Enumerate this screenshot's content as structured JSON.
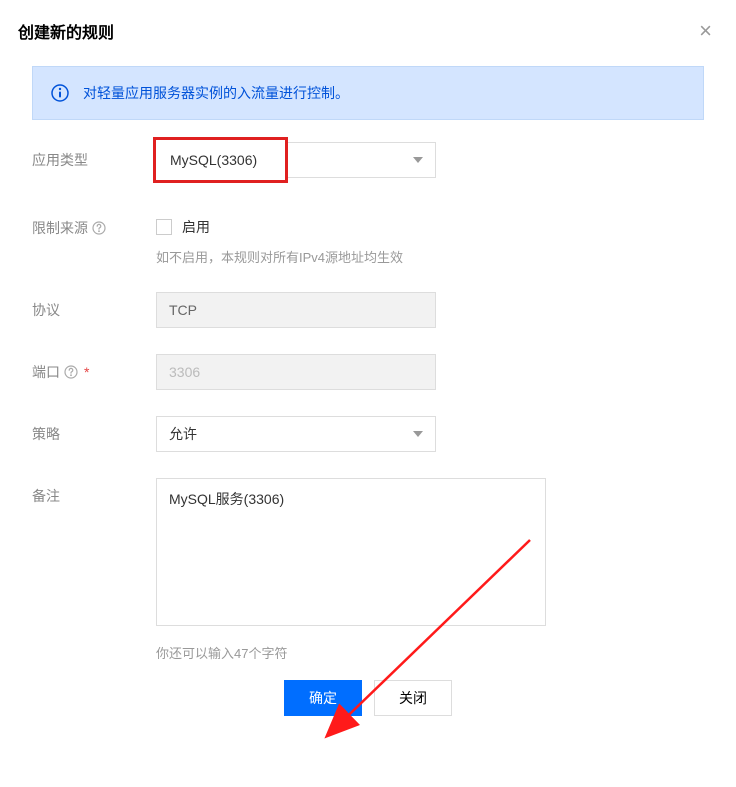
{
  "dialog": {
    "title": "创建新的规则",
    "banner": "对轻量应用服务器实例的入流量进行控制。"
  },
  "form": {
    "appType": {
      "label": "应用类型",
      "value": "MySQL(3306)"
    },
    "restrictSource": {
      "label": "限制来源",
      "checkboxLabel": "启用",
      "hint": "如不启用，本规则对所有IPv4源地址均生效"
    },
    "protocol": {
      "label": "协议",
      "value": "TCP"
    },
    "port": {
      "label": "端口",
      "value": "3306"
    },
    "policy": {
      "label": "策略",
      "value": "允许"
    },
    "remark": {
      "label": "备注",
      "value": "MySQL服务(3306)",
      "hint": "你还可以输入47个字符"
    }
  },
  "footer": {
    "confirm": "确定",
    "close": "关闭"
  }
}
